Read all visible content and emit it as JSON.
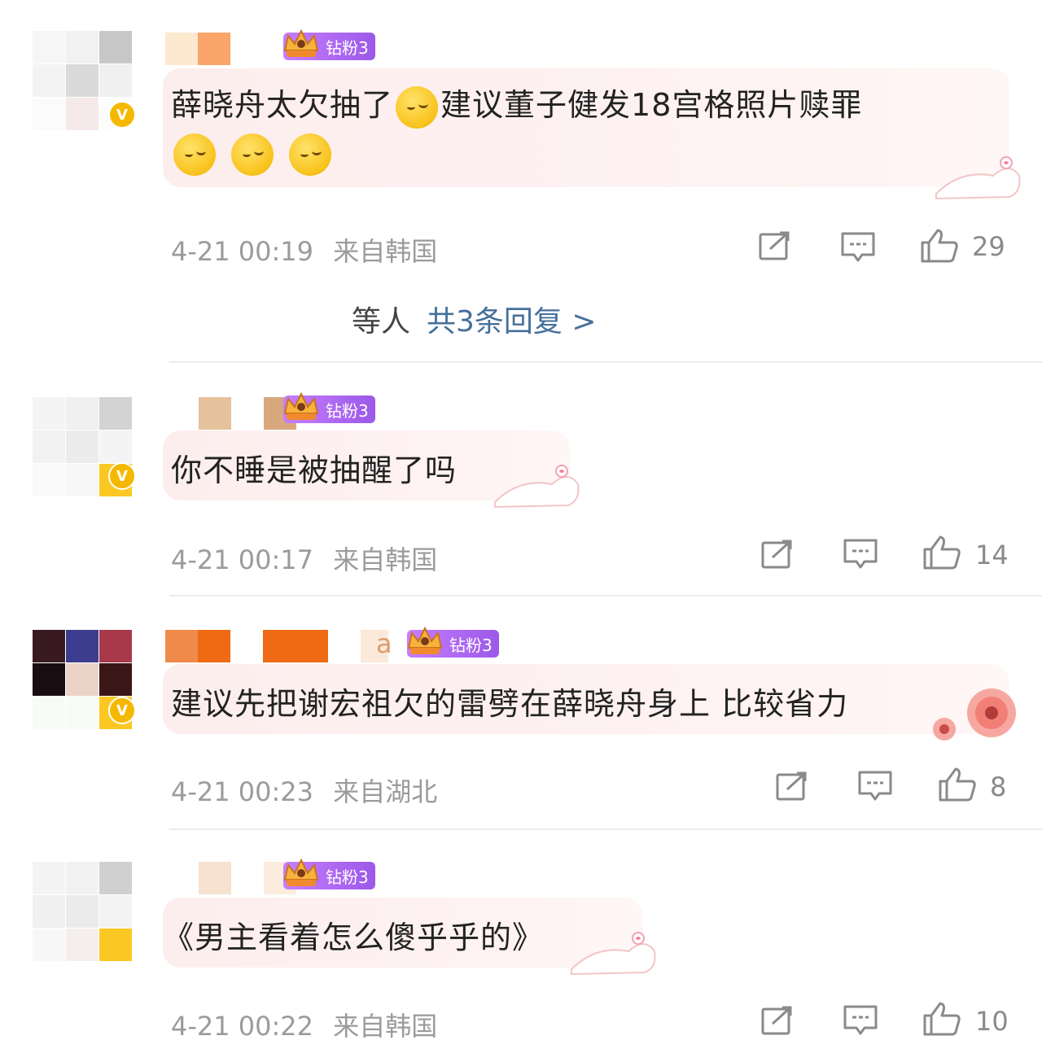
{
  "comments": [
    {
      "badge": "钻粉3",
      "text": "薛晓舟太欠抽了",
      "text2": "建议董子健发18宫格照片赎罪",
      "time": "4-21 00:19",
      "location": "来自韩国",
      "likes": "29",
      "replies": {
        "prefix": "等人",
        "link": "共3条回复 >"
      }
    },
    {
      "badge": "钻粉3",
      "text": "你不睡是被抽醒了吗",
      "time": "4-21 00:17",
      "location": "来自韩国",
      "likes": "14"
    },
    {
      "badge": "钻粉3",
      "name_fragment": "a",
      "text": "建议先把谢宏祖欠的雷劈在薛晓舟身上 比较省力",
      "time": "4-21 00:23",
      "location": "来自湖北",
      "likes": "8"
    },
    {
      "badge": "钻粉3",
      "text": "《男主看着怎么傻乎乎的》",
      "time": "4-21 00:22",
      "location": "来自韩国",
      "likes": "10"
    }
  ],
  "icons": {
    "verified": "v-badge-icon",
    "share": "share-icon",
    "reply": "comment-icon",
    "like": "thumbs-up-icon",
    "emoji": "sleepy-face-emoji"
  },
  "colors": {
    "badge_purple": "#a868f0",
    "link_blue": "#46709b",
    "meta_gray": "#9b9b9b",
    "verified_gold": "#f5b800"
  }
}
